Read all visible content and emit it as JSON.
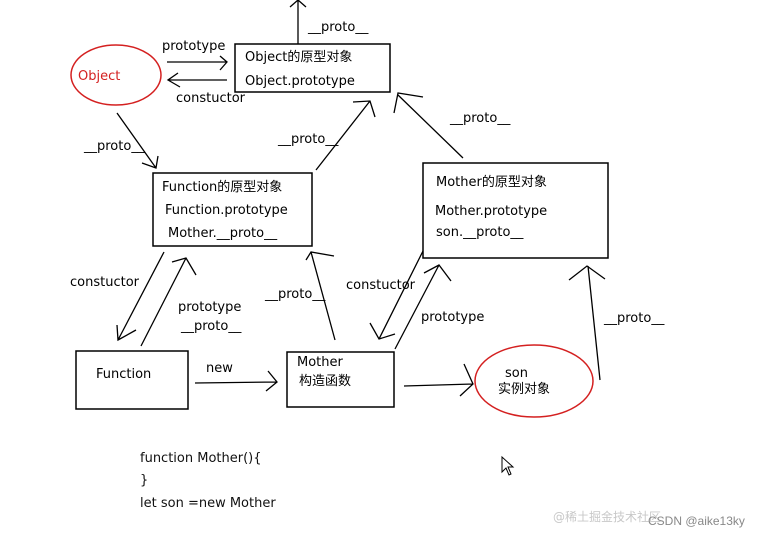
{
  "nodes": {
    "object": {
      "label": "Object",
      "shape": "ellipse",
      "color": "#d42020"
    },
    "object_proto": {
      "lines": [
        "Object的原型对象",
        "Object.prototype"
      ]
    },
    "function_proto": {
      "lines": [
        "Function的原型对象",
        "Function.prototype",
        "Mother.__proto__"
      ]
    },
    "mother_proto": {
      "lines": [
        "Mother的原型对象",
        "Mother.prototype",
        "son.__proto__"
      ]
    },
    "function": {
      "label": "Function"
    },
    "mother": {
      "lines": [
        "Mother",
        "构造函数"
      ]
    },
    "son": {
      "lines": [
        "son",
        "实例对象"
      ],
      "shape": "ellipse",
      "color": "#d42020"
    }
  },
  "edges": {
    "object_to_object_proto": "prototype",
    "object_proto_to_object": "constuctor",
    "object_proto_up": "__proto__",
    "object_to_function_proto": "__proto__",
    "function_proto_to_object_proto": "__proto__",
    "mother_proto_to_object_proto": "__proto__",
    "function_proto_to_function": "constuctor",
    "function_to_function_proto": [
      "prototype",
      "__proto__"
    ],
    "mother_to_function_proto": "__proto__",
    "function_to_mother": "new",
    "mother_proto_to_mother": "constuctor",
    "mother_to_mother_proto": "prototype",
    "son_to_mother_proto": "__proto__"
  },
  "code": [
    "function Mother(){",
    "}",
    "let son =new Mother"
  ],
  "watermark": {
    "left": "@稀土掘金技术社区",
    "right": "CSDN @aike13ky"
  }
}
